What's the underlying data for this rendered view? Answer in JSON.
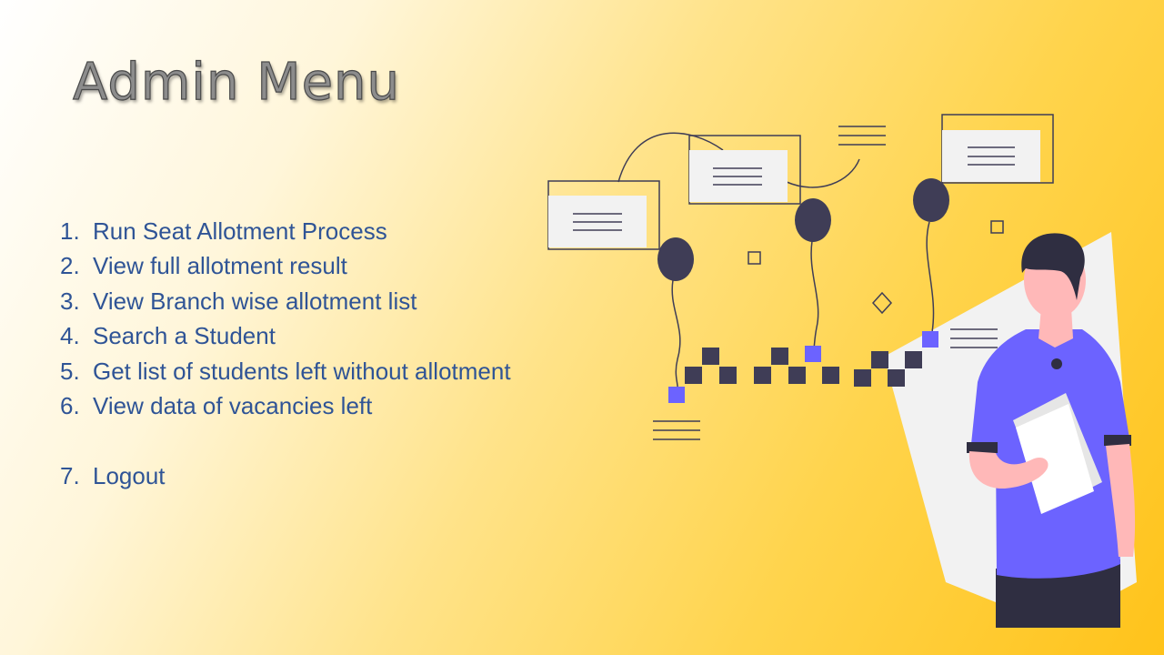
{
  "slide": {
    "title": "Admin Menu"
  },
  "menu": {
    "items": [
      {
        "number": "1.",
        "label": "Run Seat Allotment Process"
      },
      {
        "number": "2.",
        "label": "View full allotment result"
      },
      {
        "number": "3.",
        "label": "View Branch wise allotment list"
      },
      {
        "number": "4.",
        "label": "Search a Student"
      },
      {
        "number": "5.",
        "label": "Get list of students left without allotment"
      },
      {
        "number": "6.",
        "label": "View data of vacancies left"
      },
      {
        "number": "7.",
        "label": "Logout"
      }
    ]
  },
  "illustration": {
    "icon": "person-holding-documents-with-balloons-illustration",
    "colors": {
      "accent": "#6c63ff",
      "dark": "#3f3d56",
      "skin": "#ffb8b8",
      "panel": "#f2f2f2",
      "background_from": "#ffffff",
      "background_to": "#ffc31a",
      "menu_text": "#2f5496"
    }
  }
}
